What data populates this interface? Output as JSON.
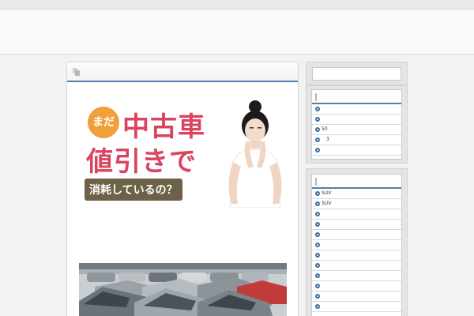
{
  "banner": {
    "badge": "まだ",
    "line1": "中古車",
    "line2": "値引きで",
    "line3": "消耗しているの？"
  },
  "sidebar": {
    "search": {
      "value": ""
    },
    "widget1_items": [
      "",
      "",
      "50",
      "　3",
      ""
    ],
    "widget2_items": [
      "SUV",
      "SUV",
      "",
      "",
      "",
      "",
      "",
      "",
      "",
      "",
      "",
      ""
    ]
  },
  "colors": {
    "accent": "#4f7fb0",
    "title_red": "#d9455f",
    "badge_orange": "#f0a03a",
    "subtitle_bg": "#6d6247"
  },
  "icons": [
    "document-icon",
    "list-bullet-icon"
  ]
}
